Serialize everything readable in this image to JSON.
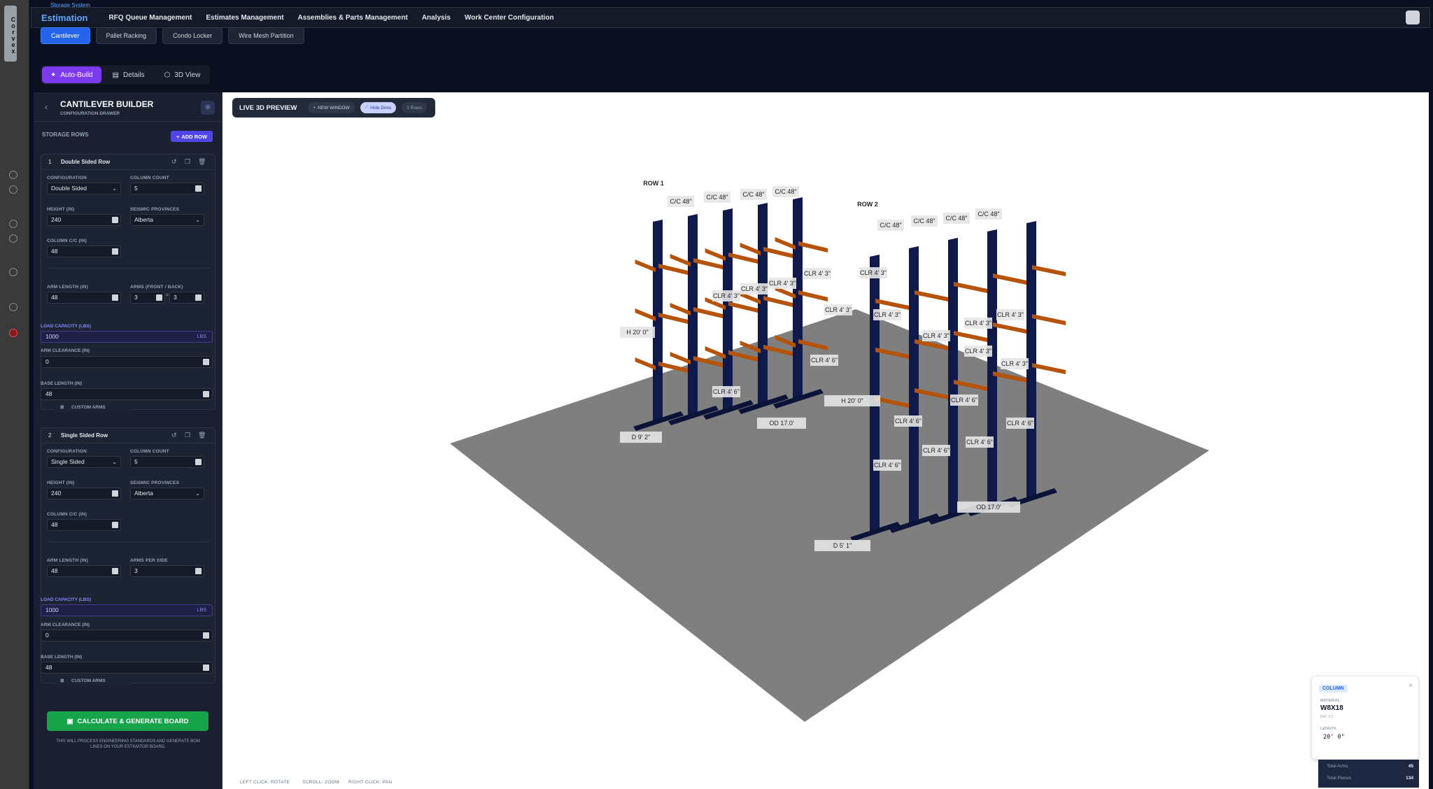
{
  "brand_vertical": "Corvex",
  "breadcrumb": "Storage System",
  "app": {
    "logo": "Estimation",
    "nav": [
      "RFQ Queue Management",
      "Estimates Management",
      "Assemblies & Parts Management",
      "Analysis",
      "Work Center Configuration"
    ]
  },
  "type_tabs": [
    "Cantilever",
    "Pallet Racking",
    "Condo Locker",
    "Wire Mesh Partition"
  ],
  "mode_tabs": [
    "Auto-Build",
    "Details",
    "3D View"
  ],
  "builder": {
    "title": "CANTILEVER BUILDER",
    "subtitle": "CONFIGURATION DRAWER",
    "storage_rows_label": "STORAGE ROWS",
    "add_row": "ADD ROW",
    "calculate_label": "CALCULATE & GENERATE BOARD",
    "calculate_note": "THIS WILL PROCESS ENGINEERING STANDARDS AND GENERATE BOM LINES ON YOUR ESTIMATOR BOARD."
  },
  "labels": {
    "configuration": "CONFIGURATION",
    "column_count": "COLUMN COUNT",
    "height": "HEIGHT (IN)",
    "seismic": "SEISMIC PROVINCES",
    "column_cc": "COLUMN C/C (IN)",
    "arm_length": "ARM LENGTH (IN)",
    "arms_front_back": "ARMS (FRONT / BACK)",
    "arms_per_side": "ARMS PER SIDE",
    "load_capacity": "LOAD CAPACITY (LBS)",
    "arm_clearance": "ARM CLEARANCE (IN)",
    "base_length": "BASE LENGTH (IN)",
    "custom_arms": "CUSTOM ARMS",
    "lbs": "LBS"
  },
  "rows": [
    {
      "num": "1",
      "name": "Double Sided Row",
      "configuration": "Double Sided",
      "column_count": "5",
      "height": "240",
      "seismic": "Alberta",
      "column_cc": "48",
      "arm_length": "48",
      "arms_front": "3",
      "arms_back": "3",
      "arms_sep": "=",
      "load_capacity": "1000",
      "arm_clearance": "0",
      "base_length": "48"
    },
    {
      "num": "2",
      "name": "Single Sided Row",
      "configuration": "Single Sided",
      "column_count": "5",
      "height": "240",
      "seismic": "Alberta",
      "column_cc": "48",
      "arm_length": "48",
      "arms_per_side": "3",
      "load_capacity": "1000",
      "arm_clearance": "0",
      "base_length": "48"
    }
  ],
  "preview": {
    "title": "LIVE 3D PREVIEW",
    "new_window": "NEW WINDOW",
    "hide_dims": "Hide Dims",
    "rows_badge": "2 Rows",
    "hints": [
      "LEFT CLICK: ROTATE",
      "SCROLL: ZOOM",
      "RIGHT CLICK: PAN"
    ]
  },
  "scene": {
    "row1_label": "ROW 1",
    "row2_label": "ROW 2",
    "cc": "C/C 48\"",
    "clr3": "CLR 4' 3\"",
    "clr6": "CLR 4' 6\"",
    "h": "H 20' 0\"",
    "od": "OD 17.0'",
    "d1": "D 9' 2\"",
    "d2": "D 5' 1\""
  },
  "popup": {
    "badge": "COLUMN",
    "material_label": "MATERIAL",
    "material": "W8X18",
    "ref": "Ref: C1",
    "length_label": "LENGTH",
    "length": "20' 0\""
  },
  "stats": [
    {
      "label": "Total Arms",
      "value": "45"
    },
    {
      "label": "Total Pieces",
      "value": "134"
    }
  ],
  "colors": {
    "accent": "#7c3aed",
    "primary": "#2563eb",
    "success": "#16a34a",
    "column": "#0f1a4a",
    "arm": "#b45309",
    "floor": "#808080"
  }
}
